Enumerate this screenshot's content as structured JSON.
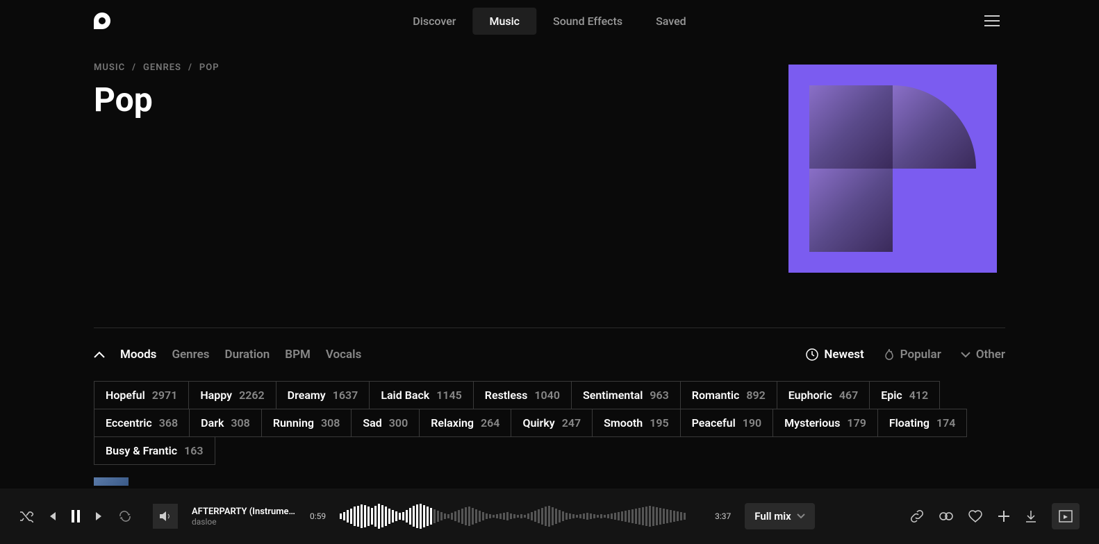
{
  "nav": {
    "items": [
      "Discover",
      "Music",
      "Sound Effects",
      "Saved"
    ],
    "active": "Music"
  },
  "breadcrumb": [
    "MUSIC",
    "GENRES",
    "POP"
  ],
  "title": "Pop",
  "filterTabs": [
    "Moods",
    "Genres",
    "Duration",
    "BPM",
    "Vocals"
  ],
  "activeFilterTab": "Moods",
  "sort": {
    "newest": "Newest",
    "popular": "Popular",
    "other": "Other"
  },
  "moods": [
    {
      "label": "Hopeful",
      "count": "2971"
    },
    {
      "label": "Happy",
      "count": "2262"
    },
    {
      "label": "Dreamy",
      "count": "1637"
    },
    {
      "label": "Laid Back",
      "count": "1145"
    },
    {
      "label": "Restless",
      "count": "1040"
    },
    {
      "label": "Sentimental",
      "count": "963"
    },
    {
      "label": "Romantic",
      "count": "892"
    },
    {
      "label": "Euphoric",
      "count": "467"
    },
    {
      "label": "Epic",
      "count": "412"
    },
    {
      "label": "Eccentric",
      "count": "368"
    },
    {
      "label": "Dark",
      "count": "308"
    },
    {
      "label": "Running",
      "count": "308"
    },
    {
      "label": "Sad",
      "count": "300"
    },
    {
      "label": "Relaxing",
      "count": "264"
    },
    {
      "label": "Quirky",
      "count": "247"
    },
    {
      "label": "Smooth",
      "count": "195"
    },
    {
      "label": "Peaceful",
      "count": "190"
    },
    {
      "label": "Mysterious",
      "count": "179"
    },
    {
      "label": "Floating",
      "count": "174"
    },
    {
      "label": "Busy & Frantic",
      "count": "163"
    }
  ],
  "player": {
    "track": "AFTERPARTY (Instrume...",
    "artist": "dasloe",
    "currentTime": "0:59",
    "duration": "3:37",
    "mixLabel": "Full mix"
  }
}
